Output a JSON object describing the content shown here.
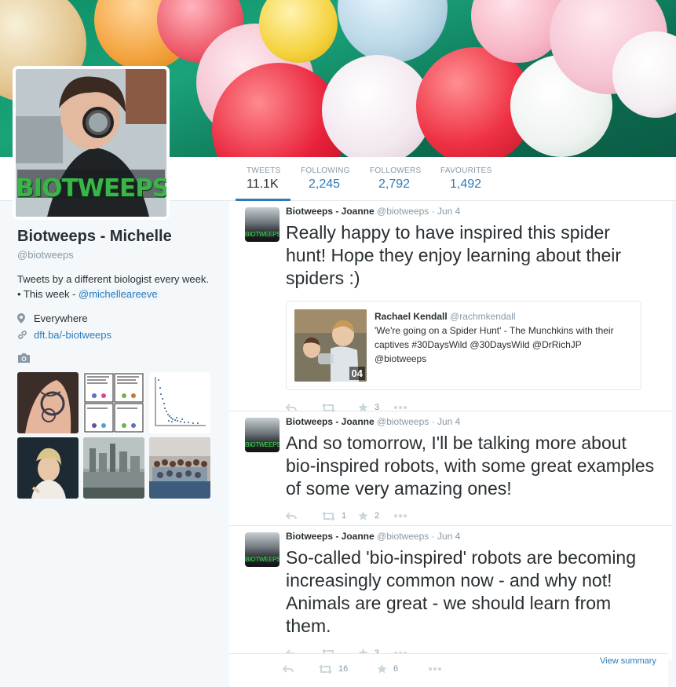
{
  "profile_nav": {
    "stats": [
      {
        "label": "TWEETS",
        "value": "11.1K",
        "active": true
      },
      {
        "label": "FOLLOWING",
        "value": "2,245"
      },
      {
        "label": "FOLLOWERS",
        "value": "2,792"
      },
      {
        "label": "FAVOURITES",
        "value": "1,492"
      }
    ]
  },
  "profile": {
    "avatar_text": "BIOTWEEPS",
    "name": "Biotweeps - Michelle",
    "handle": "@biotweeps",
    "bio_text": "Tweets by a different biologist every week. • This week -",
    "bio_mention": "@michelleareeve",
    "location": "Everywhere",
    "url": "dft.ba/-biotweeps"
  },
  "media": {
    "icon": "camera-icon"
  },
  "tweets": [
    {
      "avatar_text": "BIOTWEEPS",
      "name": "Biotweeps - Joanne",
      "handle": "@biotweeps",
      "sep": "·",
      "date": "Jun 4",
      "text": "Really happy to have inspired this spider hunt! Hope they enjoy learning about their spiders :)",
      "quote": {
        "name": "Rachael Kendall",
        "handle": "@rachmkendall",
        "text": "'We're going on a Spider Hunt' - The Munchkins with their captives #30DaysWild @30DaysWild @DrRichJP @biotweeps",
        "img_text": "04"
      },
      "retweets": "",
      "favorites": "3"
    },
    {
      "avatar_text": "BIOTWEEPS",
      "name": "Biotweeps - Joanne",
      "handle": "@biotweeps",
      "sep": "·",
      "date": "Jun 4",
      "text": "And so tomorrow, I'll be talking more about bio-inspired robots, with some great examples of some very amazing ones!",
      "retweets": "1",
      "favorites": "2"
    },
    {
      "avatar_text": "BIOTWEEPS",
      "name": "Biotweeps - Joanne",
      "handle": "@biotweeps",
      "sep": "·",
      "date": "Jun 4",
      "text": "So-called 'bio-inspired' robots are becoming increasingly common now - and why not! Animals are great - we should learn from them.",
      "retweets": "",
      "favorites": "3"
    }
  ],
  "bottom_bar": {
    "retweets": "16",
    "favorites": "6",
    "view_summary": "View summary"
  },
  "colors": {
    "link": "#2b7bb9",
    "muted": "#8899a6",
    "brand_green": "#39b54a"
  }
}
